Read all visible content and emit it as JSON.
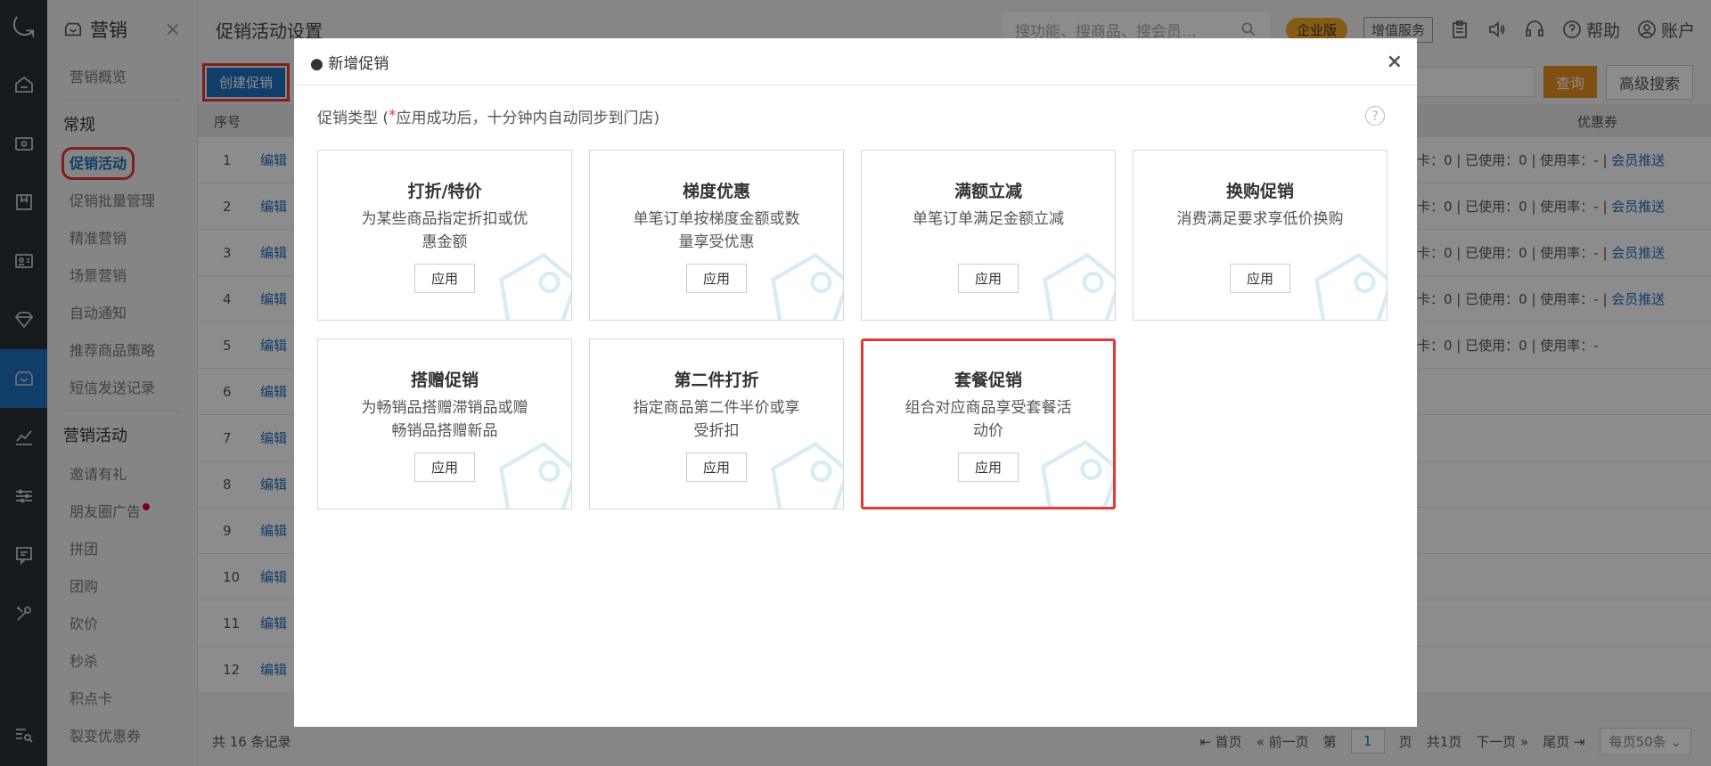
{
  "rail": {
    "logo_glyph": "⤿"
  },
  "submenu": {
    "title": "营销",
    "close": "×",
    "items_top": [
      "营销概览"
    ],
    "section1": "常规",
    "items1": [
      "促销活动",
      "促销批量管理",
      "精准营销",
      "场景营销",
      "自动通知",
      "推荐商品策略",
      "短信发送记录"
    ],
    "section2": "营销活动",
    "items2": [
      "邀请有礼",
      "朋友圈广告",
      "拼团",
      "团购",
      "砍价",
      "秒杀",
      "积点卡",
      "裂变优惠券"
    ]
  },
  "main": {
    "page_title": "促销活动设置",
    "search_placeholder": "搜功能、搜商品、搜会员…",
    "badge_enterprise": "企业版",
    "badge_vas": "增值服务",
    "help": "帮助",
    "account": "账户",
    "create_btn": "创建促销",
    "query_btn": "查询",
    "advanced_btn": "高级搜索",
    "col_seq": "序号",
    "col_coupon": "优惠券",
    "rows": [
      {
        "seq": "1",
        "edit": "编辑",
        "stat": "卡：0 | 已使用：0 | 使用率：- | ",
        "link": "会员推送"
      },
      {
        "seq": "2",
        "edit": "编辑",
        "stat": "卡：0 | 已使用：0 | 使用率：- | ",
        "link": "会员推送"
      },
      {
        "seq": "3",
        "edit": "编辑",
        "stat": "卡：0 | 已使用：0 | 使用率：- | ",
        "link": "会员推送"
      },
      {
        "seq": "4",
        "edit": "编辑",
        "stat": "卡：0 | 已使用：0 | 使用率：- | ",
        "link": "会员推送"
      },
      {
        "seq": "5",
        "edit": "编辑",
        "stat": "卡：0 | 已使用：0 | 使用率：-",
        "link": ""
      },
      {
        "seq": "6",
        "edit": "编辑",
        "stat": "",
        "link": ""
      },
      {
        "seq": "7",
        "edit": "编辑",
        "stat": "",
        "link": ""
      },
      {
        "seq": "8",
        "edit": "编辑",
        "stat": "",
        "link": ""
      },
      {
        "seq": "9",
        "edit": "编辑",
        "stat": "",
        "link": ""
      },
      {
        "seq": "10",
        "edit": "编辑",
        "stat": "",
        "link": ""
      },
      {
        "seq": "11",
        "edit": "编辑",
        "stat": "",
        "link": ""
      },
      {
        "seq": "12",
        "edit": "编辑",
        "stat": "",
        "link": ""
      }
    ],
    "total": "共 16 条记录",
    "pager": {
      "first": "首页",
      "prev": "前一页",
      "page_label": "第",
      "page": "1",
      "page_unit": "页",
      "total_pages": "共1页",
      "next": "下一页",
      "last": "尾页",
      "page_size": "每页50条"
    }
  },
  "modal": {
    "title": "● 新增促销",
    "close": "×",
    "subtitle_pre": "促销类型 (",
    "subtitle_star": "*",
    "subtitle_post": "应用成功后，十分钟内自动同步到门店)",
    "help": "?",
    "cards": [
      {
        "title": "打折/特价",
        "desc": "为某些商品指定折扣或优惠金额",
        "apply": "应用",
        "highlight": false
      },
      {
        "title": "梯度优惠",
        "desc": "单笔订单按梯度金额或数量享受优惠",
        "apply": "应用",
        "highlight": false
      },
      {
        "title": "满额立减",
        "desc": "单笔订单满足金额立减",
        "apply": "应用",
        "highlight": false
      },
      {
        "title": "换购促销",
        "desc": "消费满足要求享低价换购",
        "apply": "应用",
        "highlight": false
      },
      {
        "title": "搭赠促销",
        "desc": "为畅销品搭赠滞销品或赠畅销品搭赠新品",
        "apply": "应用",
        "highlight": false
      },
      {
        "title": "第二件打折",
        "desc": "指定商品第二件半价或享受折扣",
        "apply": "应用",
        "highlight": false
      },
      {
        "title": "套餐促销",
        "desc": "组合对应商品享受套餐活动价",
        "apply": "应用",
        "highlight": true
      }
    ]
  },
  "colors": {
    "accent": "#1e6fbf",
    "highlight": "#e53935",
    "query": "#e8911f"
  }
}
